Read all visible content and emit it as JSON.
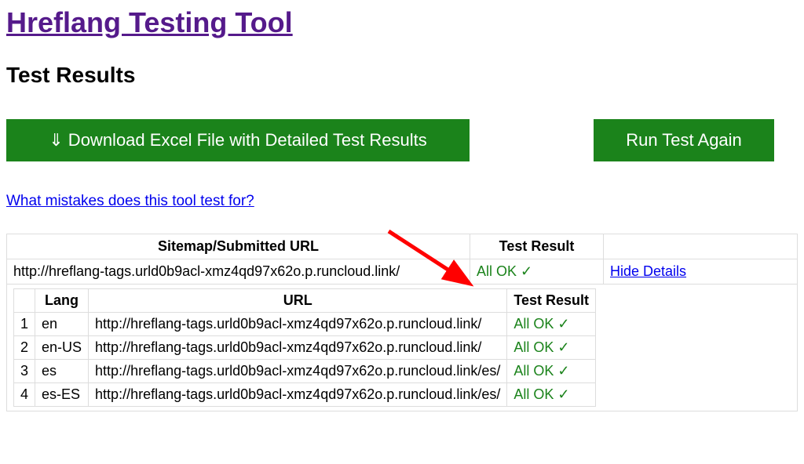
{
  "header": {
    "title_link": "Hreflang Testing Tool",
    "sub_heading": "Test Results"
  },
  "buttons": {
    "download_label": "⇓ Download Excel File with Detailed Test Results",
    "run_again_label": "Run Test Again"
  },
  "help_link_text": "What mistakes does this tool test for?",
  "table": {
    "header_url": "Sitemap/Submitted URL",
    "header_result": "Test Result",
    "submitted_url": "http://hreflang-tags.urld0b9acl-xmz4qd97x62o.p.runcloud.link/",
    "overall_status": "All OK",
    "check_symbol": "✓",
    "details_link": "Hide Details",
    "inner_headers": {
      "lang": "Lang",
      "url": "URL",
      "result": "Test Result"
    },
    "rows": [
      {
        "n": "1",
        "lang": "en",
        "url": "http://hreflang-tags.urld0b9acl-xmz4qd97x62o.p.runcloud.link/",
        "status": "All OK"
      },
      {
        "n": "2",
        "lang": "en-US",
        "url": "http://hreflang-tags.urld0b9acl-xmz4qd97x62o.p.runcloud.link/",
        "status": "All OK"
      },
      {
        "n": "3",
        "lang": "es",
        "url": "http://hreflang-tags.urld0b9acl-xmz4qd97x62o.p.runcloud.link/es/",
        "status": "All OK"
      },
      {
        "n": "4",
        "lang": "es-ES",
        "url": "http://hreflang-tags.urld0b9acl-xmz4qd97x62o.p.runcloud.link/es/",
        "status": "All OK"
      }
    ]
  }
}
